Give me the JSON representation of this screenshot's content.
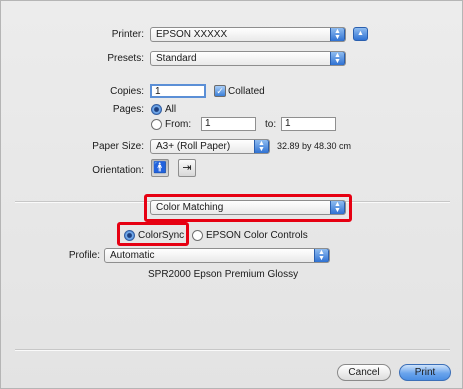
{
  "printer": {
    "label": "Printer:",
    "value": "EPSON XXXXX"
  },
  "presets": {
    "label": "Presets:",
    "value": "Standard"
  },
  "copies": {
    "label": "Copies:",
    "value": "1",
    "collated_label": "Collated"
  },
  "pages": {
    "label": "Pages:",
    "all_label": "All",
    "from_label": "From:",
    "from_value": "1",
    "to_label": "to:",
    "to_value": "1"
  },
  "paper_size": {
    "label": "Paper Size:",
    "value": "A3+ (Roll Paper)",
    "dimensions": "32.89 by 48.30 cm"
  },
  "orientation": {
    "label": "Orientation:"
  },
  "section_popup": {
    "value": "Color Matching"
  },
  "color_mode": {
    "colorsync_label": "ColorSync",
    "epson_label": "EPSON Color Controls"
  },
  "profile": {
    "label": "Profile:",
    "value": "Automatic",
    "description": "SPR2000 Epson Premium Glossy"
  },
  "buttons": {
    "cancel": "Cancel",
    "print": "Print"
  },
  "highlight_color": "#e60012"
}
